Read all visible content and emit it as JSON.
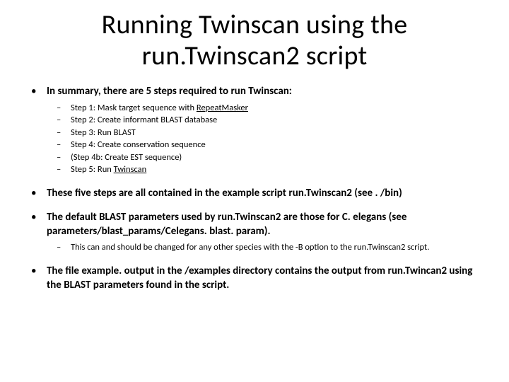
{
  "title_line1": "Running Twinscan using the",
  "title_line2": "run.Twinscan2 script",
  "bullets": [
    {
      "text": "In summary, there are 5 steps required to run Twinscan:",
      "sub": [
        {
          "pre": "Step 1: Mask target sequence with ",
          "u": "RepeatMasker",
          "post": ""
        },
        {
          "pre": "Step 2: Create informant BLAST database",
          "u": "",
          "post": ""
        },
        {
          "pre": "Step 3: Run BLAST",
          "u": "",
          "post": ""
        },
        {
          "pre": "Step 4: Create conservation sequence",
          "u": "",
          "post": ""
        },
        {
          "pre": "(Step 4b: Create EST sequence)",
          "u": "",
          "post": ""
        },
        {
          "pre": "Step 5: Run ",
          "u": "Twinscan",
          "post": ""
        }
      ]
    },
    {
      "text": "These five steps are all contained in the example script run.Twinscan2 (see . /bin)",
      "sub": []
    },
    {
      "text": "The default BLAST parameters used by run.Twinscan2 are those for C. elegans (see parameters/blast_params/Celegans. blast. param).",
      "sub": [
        {
          "pre": "This can and should be changed for any other species  with the -B option to the run.Twinscan2 script.",
          "u": "",
          "post": ""
        }
      ]
    },
    {
      "text": "The file example. output in the /examples directory contains the output from run.Twincan2 using the BLAST parameters found in the script.",
      "sub": []
    }
  ]
}
